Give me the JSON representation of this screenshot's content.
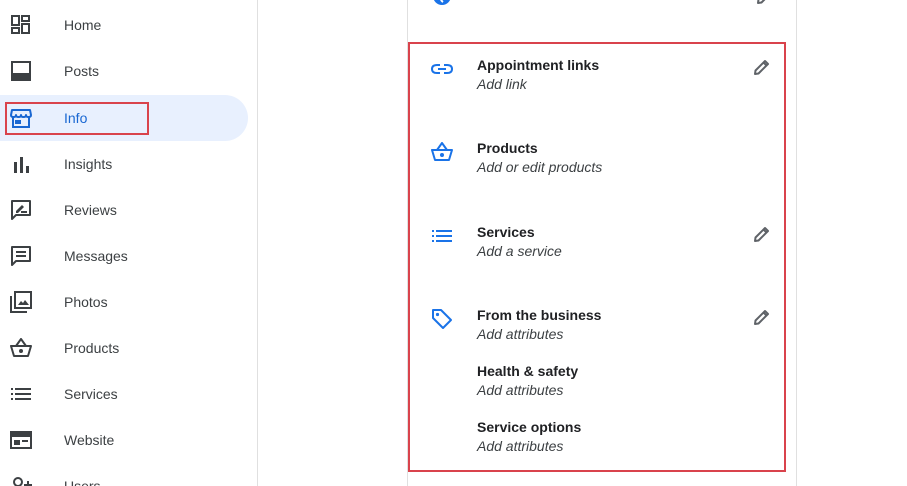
{
  "sidebar": {
    "items": [
      {
        "label": "Home",
        "icon": "dashboard-icon"
      },
      {
        "label": "Posts",
        "icon": "posts-icon"
      },
      {
        "label": "Info",
        "icon": "storefront-icon",
        "active": true
      },
      {
        "label": "Insights",
        "icon": "bar-chart-icon"
      },
      {
        "label": "Reviews",
        "icon": "reviews-icon"
      },
      {
        "label": "Messages",
        "icon": "message-icon"
      },
      {
        "label": "Photos",
        "icon": "photos-icon"
      },
      {
        "label": "Products",
        "icon": "basket-icon"
      },
      {
        "label": "Services",
        "icon": "list-icon"
      },
      {
        "label": "Website",
        "icon": "website-icon"
      },
      {
        "label": "Users",
        "icon": "add-user-icon"
      }
    ]
  },
  "main": {
    "sections": [
      {
        "title": "Appointment links",
        "subtitle": "Add link",
        "icon": "link-icon",
        "editable": true
      },
      {
        "title": "Products",
        "subtitle": "Add or edit products",
        "icon": "basket-icon",
        "editable": false
      },
      {
        "title": "Services",
        "subtitle": "Add a service",
        "icon": "list-icon",
        "editable": true
      },
      {
        "title": "From the business",
        "subtitle": "Add attributes",
        "icon": "tag-icon",
        "editable": true
      },
      {
        "title": "Health & safety",
        "subtitle": "Add attributes",
        "editable": false
      },
      {
        "title": "Service options",
        "subtitle": "Add attributes",
        "editable": false
      }
    ]
  },
  "colors": {
    "accent": "#1a73e8",
    "active_bg": "#e8f0fe",
    "active_text": "#1967d2",
    "highlight": "#d9434c",
    "icon_gray": "#3c4043"
  }
}
